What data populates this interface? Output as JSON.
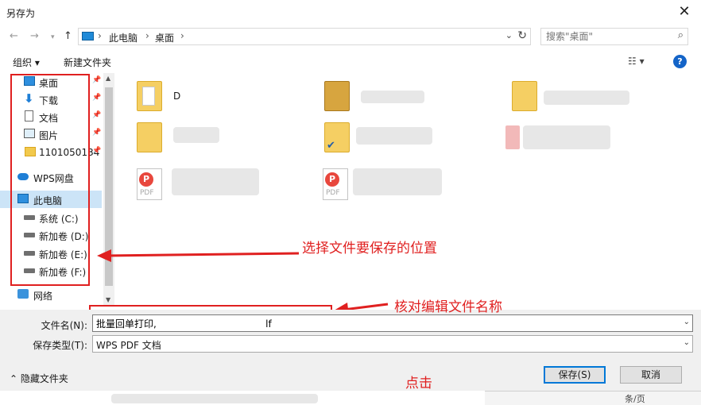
{
  "window": {
    "title": "另存为"
  },
  "nav": {
    "breadcrumb": [
      "此电脑",
      "桌面"
    ],
    "search_placeholder": "搜索\"桌面\""
  },
  "toolbar": {
    "organize": "组织 ▾",
    "new_folder": "新建文件夹"
  },
  "sidebar": {
    "items": [
      {
        "label": "桌面",
        "icon": "desktop-icon",
        "pinned": true
      },
      {
        "label": "下载",
        "icon": "download-icon",
        "pinned": true
      },
      {
        "label": "文档",
        "icon": "document-icon",
        "pinned": true
      },
      {
        "label": "图片",
        "icon": "pictures-icon",
        "pinned": true
      },
      {
        "label": "1101050134",
        "icon": "folder-icon",
        "pinned": true
      },
      {
        "label": "WPS网盘",
        "icon": "cloud-icon",
        "pinned": false
      },
      {
        "label": "此电脑",
        "icon": "computer-icon",
        "pinned": false
      },
      {
        "label": "系统 (C:)",
        "icon": "drive-icon",
        "pinned": false
      },
      {
        "label": "新加卷 (D:)",
        "icon": "drive-icon",
        "pinned": false
      },
      {
        "label": "新加卷 (E:)",
        "icon": "drive-icon",
        "pinned": false
      },
      {
        "label": "新加卷 (F:)",
        "icon": "drive-icon",
        "pinned": false
      },
      {
        "label": "网络",
        "icon": "network-icon",
        "pinned": false
      }
    ]
  },
  "files": {
    "items": [
      {
        "label": "D",
        "icon": "folder-icon"
      },
      {
        "label": "",
        "icon": "folder-icon"
      },
      {
        "label": "",
        "icon": "folder-icon"
      },
      {
        "label": "",
        "icon": "folder-icon"
      },
      {
        "label": "",
        "icon": "folder-icon"
      },
      {
        "label": "",
        "icon": "image-file-icon"
      },
      {
        "label": "PDF",
        "icon": "pdf-file-icon"
      },
      {
        "label": "PDF",
        "icon": "pdf-file-icon"
      }
    ]
  },
  "form": {
    "filename_label": "文件名(N):",
    "filename_value": "批量回单打印,                                    lf",
    "filetype_label": "保存类型(T):",
    "filetype_value": "WPS PDF 文档"
  },
  "footer": {
    "hide_folders": "隐藏文件夹",
    "save": "保存(S)",
    "cancel": "取消"
  },
  "annotations": {
    "location": "选择文件要保存的位置",
    "filename": "核对编辑文件名称",
    "click": "点击"
  },
  "background": {
    "page_label": "条/页"
  },
  "colors": {
    "annotation_red": "#e02020",
    "selection_blue": "#cce4f7",
    "accent_blue": "#0078d7"
  }
}
